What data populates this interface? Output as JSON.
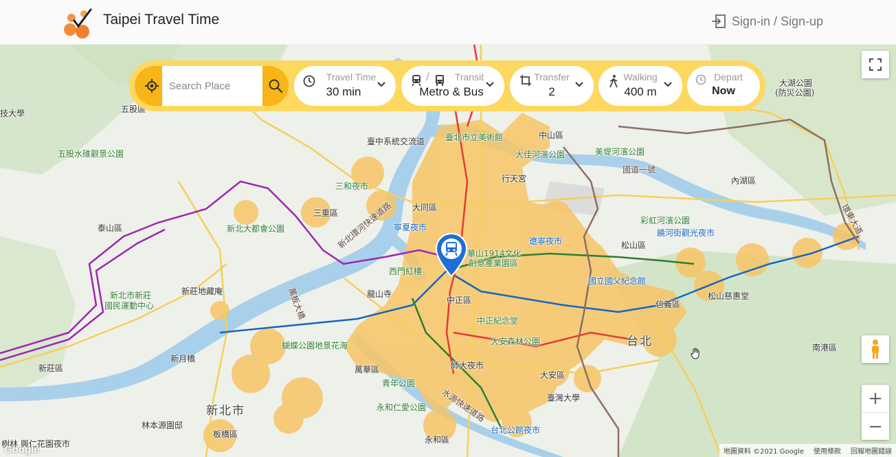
{
  "header": {
    "title": "Taipei Travel Time",
    "signin_label": "Sign-in / Sign-up",
    "logo_icon": "orange-dots-check-logo",
    "signin_icon": "sign-in-icon"
  },
  "toolbar": {
    "search_placeholder": "Search Place",
    "travel_time": {
      "caption": "Travel Time",
      "value": "30 min",
      "icon": "clock-icon"
    },
    "transit": {
      "caption_sep": "/",
      "caption": "Transit",
      "value": "Metro & Bus",
      "icons": [
        "metro-icon",
        "bus-icon"
      ]
    },
    "transfer": {
      "caption": "Transfer",
      "value": "2",
      "icon": "transfer-icon"
    },
    "walking": {
      "caption": "Walking",
      "value": "400 m",
      "icon": "walking-icon"
    },
    "depart": {
      "caption": "Depart",
      "value": "Now",
      "icon": "clock-icon"
    },
    "accent_color": "#fdd860",
    "button_color": "#f7b518"
  },
  "map": {
    "labels": {
      "l1": "技大學",
      "l2": "五股區",
      "l3": "五股水碓觀景公園",
      "l4": "三和夜市",
      "l5": "三重區",
      "l6": "泰山區",
      "l7": "新北大都會公園",
      "l8": "新北市新莊",
      "l9": "國民運動中心",
      "l10": "新莊地藏庵",
      "l11": "新月橋",
      "l12": "新莊區",
      "l13": "新北市",
      "l14": "林本源園邸",
      "l15": "板橋區",
      "l16": "樹林 興仁花園夜市",
      "l17": "臺中系統交流道",
      "l18": "臺北市立美術館",
      "l19": "中山區",
      "l20": "大佳河濱公園",
      "l21": "美堤河濱公園",
      "l22": "行天宮",
      "l23": "大同區",
      "l24": "寧夏夜市",
      "l25": "遼寧夜市",
      "l26": "華山1914文化",
      "l27": "創意產業園區",
      "l28": "西門紅樓",
      "l29": "中正區",
      "l30": "龍山寺",
      "l31": "中正紀念堂",
      "l32": "大安森林公園",
      "l33": "國立國父紀念館",
      "l34": "信義區",
      "l35": "松山區",
      "l36": "彩虹河濱公園",
      "l37": "饒河街觀光夜市",
      "l38": "松山慈惠堂",
      "l39": "台北",
      "l40": "蝴蝶公園地景花海",
      "l41": "萬華區",
      "l42": "青年公園",
      "l43": "師大夜市",
      "l44": "大安區",
      "l45": "臺灣大學",
      "l46": "永和仁愛公園",
      "l47": "永和區",
      "l48": "台北公館夜市",
      "l49": "大湖公園",
      "l50": "(防災公園)",
      "l51": "內湖區",
      "l52": "南港區",
      "l53": "國道一號",
      "l54": "新北環河快速道路",
      "l55": "水源快速道路",
      "l56": "環東大道",
      "l57": "萬板大橋"
    },
    "attribution": [
      "地圖資料 ©2021 Google",
      "使用條款",
      "回報地圖錯誤"
    ],
    "google_logo": "Google",
    "controls": [
      "fullscreen-icon",
      "pegman-icon",
      "zoom-in-icon",
      "zoom-out-icon"
    ],
    "isochrone_color": "#f7c566",
    "zoom_in": "+",
    "zoom_out": "−"
  }
}
